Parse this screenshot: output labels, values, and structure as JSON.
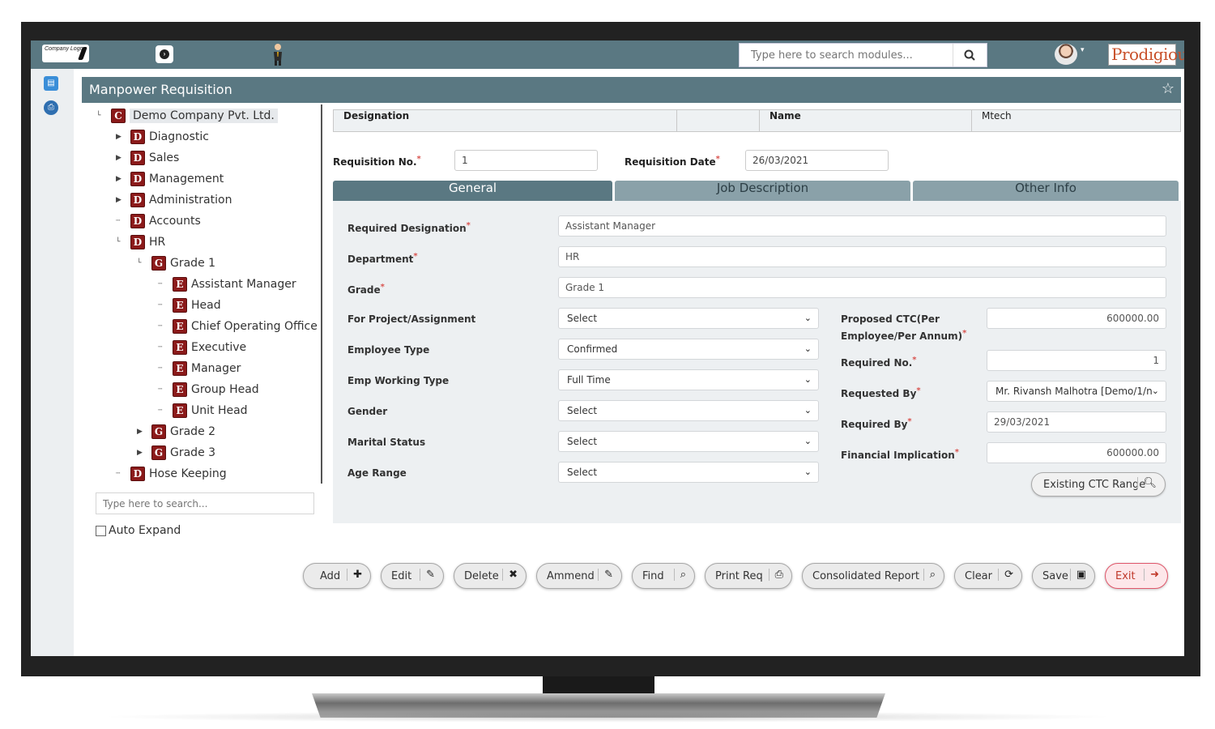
{
  "topbar": {
    "logo_text": "Company Logo",
    "search_placeholder": "Type here to search modules...",
    "brand_text": "Prodigious"
  },
  "page": {
    "title": "Manpower Requisition"
  },
  "tree": {
    "root": "Demo Company Pvt. Ltd.",
    "nodes": [
      {
        "badge": "D",
        "label": "Diagnostic"
      },
      {
        "badge": "D",
        "label": "Sales"
      },
      {
        "badge": "D",
        "label": "Management"
      },
      {
        "badge": "D",
        "label": "Administration"
      },
      {
        "badge": "D",
        "label": "Accounts"
      },
      {
        "badge": "D",
        "label": "HR"
      },
      {
        "badge": "G",
        "label": "Grade 1"
      },
      {
        "badge": "E",
        "label": "Assistant Manager"
      },
      {
        "badge": "E",
        "label": "Head"
      },
      {
        "badge": "E",
        "label": "Chief Operating Office"
      },
      {
        "badge": "E",
        "label": "Executive"
      },
      {
        "badge": "E",
        "label": "Manager"
      },
      {
        "badge": "E",
        "label": "Group Head"
      },
      {
        "badge": "E",
        "label": "Unit Head"
      },
      {
        "badge": "G",
        "label": "Grade 2"
      },
      {
        "badge": "G",
        "label": "Grade 3"
      },
      {
        "badge": "D",
        "label": "Hose Keeping"
      }
    ],
    "search_placeholder": "Type here to search...",
    "auto_expand_label": "Auto Expand"
  },
  "designation_bar": {
    "designation_label": "Designation",
    "designation_value": "",
    "name_label": "Name",
    "name_value": "Mtech"
  },
  "requisition": {
    "no_label": "Requisition No.",
    "no_value": "1",
    "date_label": "Requisition Date",
    "date_value": "26/03/2021"
  },
  "tabs": [
    "General",
    "Job Description",
    "Other Info"
  ],
  "form": {
    "required_designation": {
      "label": "Required Designation",
      "value": "Assistant Manager"
    },
    "department": {
      "label": "Department",
      "value": "HR"
    },
    "grade": {
      "label": "Grade",
      "value": "Grade 1"
    },
    "project": {
      "label": "For Project/Assignment",
      "value": "Select"
    },
    "employee_type": {
      "label": "Employee Type",
      "value": "Confirmed"
    },
    "working_type": {
      "label": "Emp Working Type",
      "value": "Full Time"
    },
    "gender": {
      "label": "Gender",
      "value": "Select"
    },
    "marital_status": {
      "label": "Marital Status",
      "value": "Select"
    },
    "age_range": {
      "label": "Age Range",
      "value": "Select"
    },
    "proposed_ctc": {
      "label": "Proposed CTC(Per Employee/Per Annum)",
      "value": "600000.00"
    },
    "required_no": {
      "label": "Required No.",
      "value": "1"
    },
    "requested_by": {
      "label": "Requested By",
      "value": "Mr. Rivansh Malhotra [Demo/1/n"
    },
    "required_by": {
      "label": "Required By",
      "value": "29/03/2021"
    },
    "financial_implication": {
      "label": "Financial Implication",
      "value": "600000.00"
    },
    "ctc_range_button": "Existing CTC Range"
  },
  "actions": {
    "add": "Add",
    "edit": "Edit",
    "delete": "Delete",
    "amend": "Ammend",
    "find": "Find",
    "print": "Print Req",
    "report": "Consolidated Report",
    "clear": "Clear",
    "save": "Save",
    "exit": "Exit"
  },
  "colors": {
    "header": "#5a7882",
    "tab_inactive": "#8aa1a9",
    "badge": "#8b1a1a",
    "required_star": "#d9534f",
    "exit": "#e0566a"
  }
}
